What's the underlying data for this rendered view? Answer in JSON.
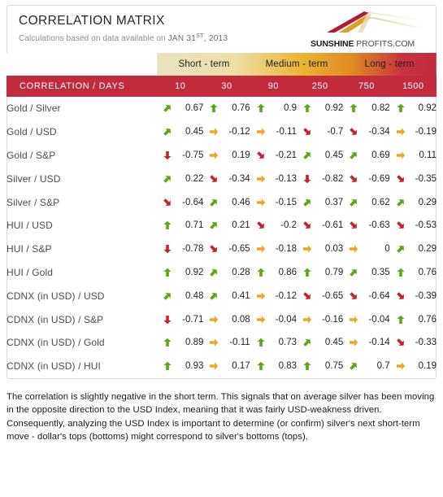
{
  "header": {
    "title": "CORRELATION MATRIX",
    "subtitle_prefix": "Calculations based on data available on",
    "date_main": "JAN 31",
    "date_sup": "ST",
    "date_year": ", 2013",
    "logo_bold": "SUNSHINE",
    "logo_normal": " PROFITS.COM"
  },
  "colors": {
    "header_red": "#c22b3c",
    "arrow_up": "#5aa813",
    "arrow_flat": "#f0a51e",
    "arrow_down": "#c8202f",
    "grad_start": "#e8e2bf",
    "grad_mid": "#e8a81c",
    "grad_end": "#c22b3c"
  },
  "table": {
    "terms": [
      {
        "label": "Short - term",
        "span": 2
      },
      {
        "label": "Medium - term",
        "span": 2
      },
      {
        "label": "Long - term",
        "span": 2
      }
    ],
    "corner_label": "CORRELATION / DAYS",
    "days": [
      "10",
      "30",
      "90",
      "250",
      "750",
      "1500"
    ],
    "rows": [
      {
        "label": "Gold / Silver",
        "cells": [
          {
            "value": "0.67",
            "arrow": "up-right"
          },
          {
            "value": "0.76",
            "arrow": "up"
          },
          {
            "value": "0.9",
            "arrow": "up"
          },
          {
            "value": "0.92",
            "arrow": "up"
          },
          {
            "value": "0.82",
            "arrow": "up"
          },
          {
            "value": "0.92",
            "arrow": "up"
          }
        ]
      },
      {
        "label": "Gold / USD",
        "cells": [
          {
            "value": "0.45",
            "arrow": "up-right"
          },
          {
            "value": "-0.12",
            "arrow": "flat"
          },
          {
            "value": "-0.11",
            "arrow": "flat"
          },
          {
            "value": "-0.7",
            "arrow": "down-right"
          },
          {
            "value": "-0.34",
            "arrow": "down-right"
          },
          {
            "value": "-0.19",
            "arrow": "flat"
          }
        ]
      },
      {
        "label": "Gold / S&P",
        "cells": [
          {
            "value": "-0.75",
            "arrow": "down"
          },
          {
            "value": "0.19",
            "arrow": "flat"
          },
          {
            "value": "-0.21",
            "arrow": "down-right"
          },
          {
            "value": "0.45",
            "arrow": "up-right"
          },
          {
            "value": "0.69",
            "arrow": "up-right"
          },
          {
            "value": "0.11",
            "arrow": "flat"
          }
        ]
      },
      {
        "label": "Silver / USD",
        "cells": [
          {
            "value": "0.22",
            "arrow": "up-right"
          },
          {
            "value": "-0.34",
            "arrow": "down-right"
          },
          {
            "value": "-0.13",
            "arrow": "flat"
          },
          {
            "value": "-0.82",
            "arrow": "down"
          },
          {
            "value": "-0.69",
            "arrow": "down-right"
          },
          {
            "value": "-0.35",
            "arrow": "down-right"
          }
        ]
      },
      {
        "label": "Silver / S&P",
        "cells": [
          {
            "value": "-0.64",
            "arrow": "down-right"
          },
          {
            "value": "0.46",
            "arrow": "up-right"
          },
          {
            "value": "-0.15",
            "arrow": "flat"
          },
          {
            "value": "0.37",
            "arrow": "up-right"
          },
          {
            "value": "0.62",
            "arrow": "up-right"
          },
          {
            "value": "0.29",
            "arrow": "up-right"
          }
        ]
      },
      {
        "label": "HUI / USD",
        "cells": [
          {
            "value": "0.71",
            "arrow": "up"
          },
          {
            "value": "0.21",
            "arrow": "up-right"
          },
          {
            "value": "-0.2",
            "arrow": "down-right"
          },
          {
            "value": "-0.61",
            "arrow": "down-right"
          },
          {
            "value": "-0.63",
            "arrow": "down-right"
          },
          {
            "value": "-0.53",
            "arrow": "down-right"
          }
        ]
      },
      {
        "label": "HUI / S&P",
        "cells": [
          {
            "value": "-0.78",
            "arrow": "down"
          },
          {
            "value": "-0.65",
            "arrow": "down-right"
          },
          {
            "value": "-0.18",
            "arrow": "flat"
          },
          {
            "value": "0.03",
            "arrow": "flat"
          },
          {
            "value": "0",
            "arrow": "flat"
          },
          {
            "value": "0.29",
            "arrow": "up-right"
          }
        ]
      },
      {
        "label": "HUI / Gold",
        "cells": [
          {
            "value": "0.92",
            "arrow": "up"
          },
          {
            "value": "0.28",
            "arrow": "up-right"
          },
          {
            "value": "0.86",
            "arrow": "up"
          },
          {
            "value": "0.79",
            "arrow": "up"
          },
          {
            "value": "0.35",
            "arrow": "up-right"
          },
          {
            "value": "0.76",
            "arrow": "up"
          }
        ]
      },
      {
        "label": "CDNX (in USD) / USD",
        "cells": [
          {
            "value": "0.48",
            "arrow": "up-right"
          },
          {
            "value": "0.41",
            "arrow": "up-right"
          },
          {
            "value": "-0.12",
            "arrow": "flat"
          },
          {
            "value": "-0.65",
            "arrow": "down-right"
          },
          {
            "value": "-0.64",
            "arrow": "down-right"
          },
          {
            "value": "-0.39",
            "arrow": "down-right"
          }
        ]
      },
      {
        "label": "CDNX (in USD) / S&P",
        "cells": [
          {
            "value": "-0.71",
            "arrow": "down"
          },
          {
            "value": "0.08",
            "arrow": "flat"
          },
          {
            "value": "-0.04",
            "arrow": "flat"
          },
          {
            "value": "-0.16",
            "arrow": "flat"
          },
          {
            "value": "-0.04",
            "arrow": "flat"
          },
          {
            "value": "0.76",
            "arrow": "up"
          }
        ]
      },
      {
        "label": "CDNX (in USD) / Gold",
        "cells": [
          {
            "value": "0.89",
            "arrow": "up"
          },
          {
            "value": "-0.11",
            "arrow": "flat"
          },
          {
            "value": "0.73",
            "arrow": "up"
          },
          {
            "value": "0.45",
            "arrow": "up-right"
          },
          {
            "value": "-0.14",
            "arrow": "flat"
          },
          {
            "value": "-0.33",
            "arrow": "down-right"
          }
        ]
      },
      {
        "label": "CDNX (in USD) / HUI",
        "cells": [
          {
            "value": "0.93",
            "arrow": "up"
          },
          {
            "value": "0.17",
            "arrow": "flat"
          },
          {
            "value": "0.83",
            "arrow": "up"
          },
          {
            "value": "0.75",
            "arrow": "up"
          },
          {
            "value": "0.7",
            "arrow": "up-right"
          },
          {
            "value": "0.19",
            "arrow": "flat"
          }
        ]
      }
    ]
  },
  "commentary": "The correlation is slightly negative in the short term. This signals that on average silver has been moving in the opposite direction to the USD Index, meaning that it was fairly USD-weakness driven. Consequently, analyzing the USD Index is important to determine (or confirm) silver's next short-term move - dollar's tops (bottoms) might correspond to silver's bottoms (tops)."
}
